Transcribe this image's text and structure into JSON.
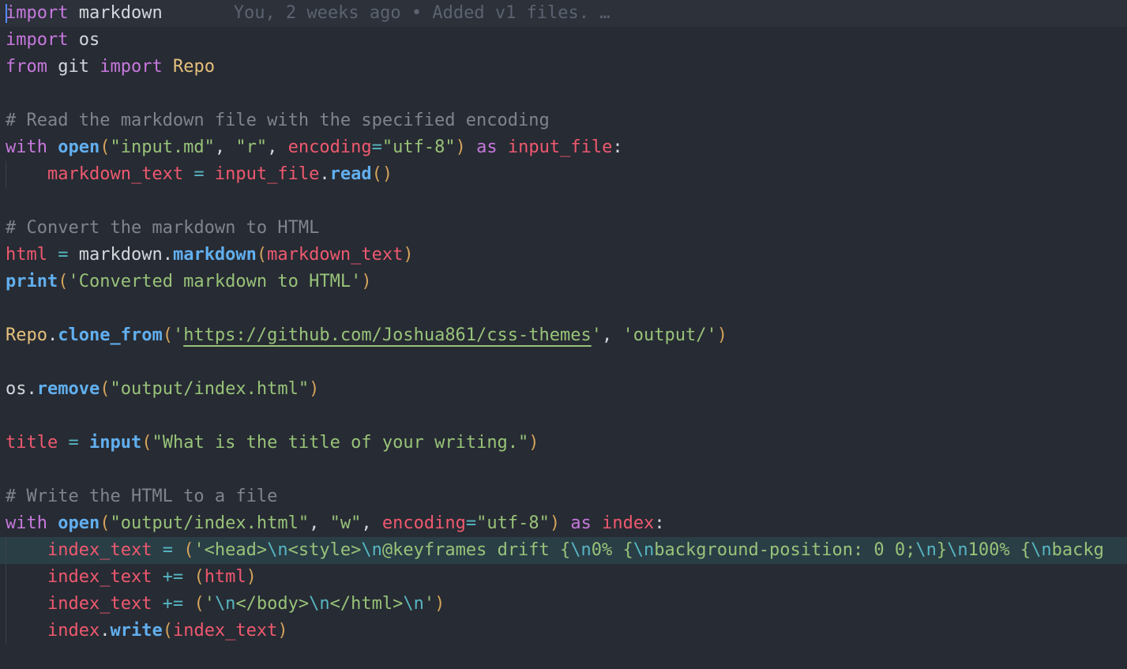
{
  "editor": {
    "language": "python",
    "blame": "You, 2 weeks ago • Added v1 files. …",
    "lines": [
      [
        "import",
        "markdown"
      ],
      [
        "import",
        "os"
      ],
      [
        "from",
        "git",
        "import",
        "Repo"
      ],
      [],
      [
        "# Read the markdown file with the specified encoding"
      ],
      [
        "with",
        "open",
        "(",
        "\"input.md\"",
        ", ",
        "\"r\"",
        ", ",
        "encoding",
        "=",
        "\"utf-8\"",
        ")",
        "as",
        "input_file",
        ":"
      ],
      [
        "markdown_text",
        "=",
        "input_file",
        ".",
        "read",
        "()"
      ],
      [],
      [
        "# Convert the markdown to HTML"
      ],
      [
        "html",
        "=",
        "markdown",
        ".",
        "markdown",
        "(",
        "markdown_text",
        ")"
      ],
      [
        "print",
        "(",
        "'Converted markdown to HTML'",
        ")"
      ],
      [],
      [
        "Repo",
        ".",
        "clone_from",
        "(",
        "'",
        "https://github.com/Joshua861/css-themes",
        "'",
        ", ",
        "'output/'",
        ")"
      ],
      [],
      [
        "os",
        ".",
        "remove",
        "(",
        "\"output/index.html\"",
        ")"
      ],
      [],
      [
        "title",
        "=",
        "input",
        "(",
        "\"What is the title of your writing.\"",
        ")"
      ],
      [],
      [
        "# Write the HTML to a file"
      ],
      [
        "with",
        "open",
        "(",
        "\"output/index.html\"",
        ", ",
        "\"w\"",
        ", ",
        "encoding",
        "=",
        "\"utf-8\"",
        ")",
        "as",
        "index",
        ":"
      ],
      [
        "index_text",
        "=",
        "(",
        "'<head>",
        "\\n",
        "<style>",
        "\\n",
        "@keyframes drift {",
        "\\n",
        "0% {",
        "\\n",
        "background-position: 0 0;",
        "\\n",
        "}",
        "\\n",
        "100% {",
        "\\n",
        "backg"
      ],
      [
        "index_text",
        "+=",
        "(",
        "html",
        ")"
      ],
      [
        "index_text",
        "+=",
        "(",
        "'",
        "\\n",
        "</body>",
        "\\n",
        "</html>",
        "\\n",
        "'",
        ")"
      ],
      [
        "index",
        ".",
        "write",
        "(",
        "index_text",
        ")"
      ]
    ]
  }
}
